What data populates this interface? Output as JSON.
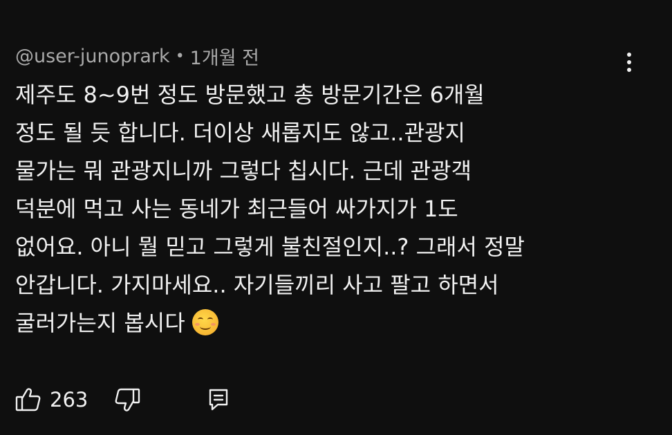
{
  "comment": {
    "author": "@user-junoprark",
    "separator": "•",
    "time": "1개월 전",
    "body_lines": [
      "제주도 8~9번 정도 방문했고 총 방문기간은 6개월",
      "정도 될 듯 합니다. 더이상 새롭지도 않고..관광지",
      "물가는 뭐 관광지니까 그렇다 칩시다. 근데 관광객",
      "덕분에 먹고 사는 동네가 최근들어 싸가지가 1도",
      "없어요. 아니 뭘 믿고 그렇게 불친절인지..? 그래서 정말",
      "안갑니다. 가지마세요.. 자기들끼리 사고 팔고 하면서",
      "굴러가는지 봅시다"
    ],
    "emoji": "smiling-face-icon",
    "like_count": "263"
  },
  "icons": {
    "more": "more-vert-icon",
    "like": "thumbs-up-icon",
    "dislike": "thumbs-down-icon",
    "reply": "reply-comment-icon"
  },
  "colors": {
    "background": "#0f0f0f",
    "text": "#f1f1f1",
    "meta": "#aaaaaa"
  }
}
